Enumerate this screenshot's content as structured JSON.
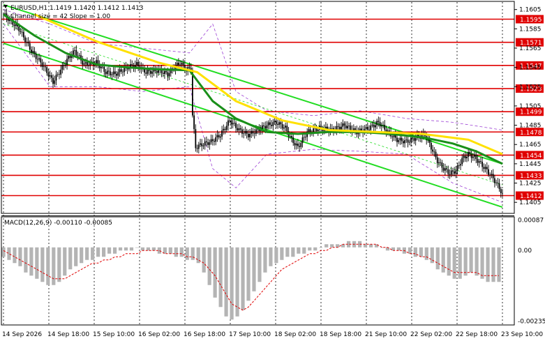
{
  "chart_data": {
    "type": "candlestick",
    "header": {
      "symbol_line": "EURUSD,H1  1.1419 1.1420 1.1412 1.1413",
      "channel_line": "Channel size = 42 Slope = 1.00"
    },
    "price_axis": {
      "ylim": [
        1.1395,
        1.1612
      ],
      "ticks": [
        "1.1605",
        "1.1585",
        "1.1565",
        "1.1545",
        "1.1525",
        "1.1505",
        "1.1485",
        "1.1465",
        "1.1445",
        "1.1425",
        "1.1405"
      ]
    },
    "levels": [
      {
        "value": 1.1595,
        "label": "1.1595"
      },
      {
        "value": 1.1571,
        "label": "1.1571"
      },
      {
        "value": 1.1547,
        "label": "1.1547"
      },
      {
        "value": 1.1523,
        "label": "1.1523"
      },
      {
        "value": 1.1499,
        "label": "1.1499"
      },
      {
        "value": 1.1478,
        "label": "1.1478"
      },
      {
        "value": 1.1454,
        "label": "1.1454"
      },
      {
        "value": 1.1433,
        "label": "1.1433"
      },
      {
        "value": 1.1412,
        "label": "1.1412"
      }
    ],
    "level_color": "#e00000",
    "time_axis": {
      "labels": [
        "14 Sep 2026",
        "14 Sep 18:00",
        "15 Sep 10:00",
        "16 Sep 02:00",
        "16 Sep 18:00",
        "17 Sep 10:00",
        "18 Sep 02:00",
        "18 Sep 18:00",
        "21 Sep 10:00",
        "22 Sep 02:00",
        "22 Sep 18:00",
        "23 Sep 10:00"
      ]
    },
    "close_path": [
      [
        0,
        1.16
      ],
      [
        10,
        1.1585
      ],
      [
        18,
        1.1562
      ],
      [
        25,
        1.1548
      ],
      [
        32,
        1.153
      ],
      [
        36,
        1.154
      ],
      [
        42,
        1.1555
      ],
      [
        46,
        1.1562
      ],
      [
        52,
        1.1548
      ],
      [
        60,
        1.155
      ],
      [
        66,
        1.154
      ],
      [
        72,
        1.1538
      ],
      [
        80,
        1.1545
      ],
      [
        86,
        1.1548
      ],
      [
        92,
        1.154
      ],
      [
        100,
        1.1542
      ],
      [
        106,
        1.1538
      ],
      [
        110,
        1.1545
      ],
      [
        114,
        1.155
      ],
      [
        118,
        1.1542
      ],
      [
        121,
        1.1545
      ],
      [
        122,
        1.1495
      ],
      [
        124,
        1.1462
      ],
      [
        128,
        1.1465
      ],
      [
        134,
        1.1468
      ],
      [
        140,
        1.1475
      ],
      [
        146,
        1.149
      ],
      [
        152,
        1.148
      ],
      [
        158,
        1.1475
      ],
      [
        164,
        1.148
      ],
      [
        170,
        1.1485
      ],
      [
        176,
        1.1488
      ],
      [
        182,
        1.1482
      ],
      [
        186,
        1.147
      ],
      [
        190,
        1.1462
      ],
      [
        196,
        1.1478
      ],
      [
        204,
        1.1482
      ],
      [
        212,
        1.148
      ],
      [
        220,
        1.1485
      ],
      [
        228,
        1.1478
      ],
      [
        236,
        1.1482
      ],
      [
        242,
        1.1488
      ],
      [
        248,
        1.1478
      ],
      [
        254,
        1.147
      ],
      [
        260,
        1.1468
      ],
      [
        266,
        1.1472
      ],
      [
        272,
        1.1475
      ],
      [
        276,
        1.1462
      ],
      [
        280,
        1.1448
      ],
      [
        284,
        1.144
      ],
      [
        288,
        1.1435
      ],
      [
        292,
        1.1438
      ],
      [
        296,
        1.145
      ],
      [
        300,
        1.1455
      ],
      [
        304,
        1.1452
      ],
      [
        308,
        1.1445
      ],
      [
        312,
        1.1438
      ],
      [
        316,
        1.143
      ],
      [
        320,
        1.142
      ],
      [
        322,
        1.1413
      ]
    ],
    "moving_averages": [
      {
        "color": "#1a8f1a",
        "values": [
          [
            0,
            1.16
          ],
          [
            20,
            1.1578
          ],
          [
            40,
            1.156
          ],
          [
            60,
            1.1548
          ],
          [
            80,
            1.1545
          ],
          [
            100,
            1.1543
          ],
          [
            120,
            1.1542
          ],
          [
            135,
            1.151
          ],
          [
            150,
            1.1492
          ],
          [
            170,
            1.1478
          ],
          [
            190,
            1.1476
          ],
          [
            210,
            1.1478
          ],
          [
            230,
            1.1478
          ],
          [
            250,
            1.1476
          ],
          [
            272,
            1.1472
          ],
          [
            290,
            1.1466
          ],
          [
            305,
            1.1458
          ],
          [
            322,
            1.1445
          ]
        ]
      },
      {
        "color": "#ffe100",
        "values": [
          [
            20,
            1.16
          ],
          [
            60,
            1.1572
          ],
          [
            100,
            1.155
          ],
          [
            125,
            1.154
          ],
          [
            150,
            1.151
          ],
          [
            180,
            1.149
          ],
          [
            210,
            1.148
          ],
          [
            240,
            1.1478
          ],
          [
            270,
            1.1476
          ],
          [
            300,
            1.147
          ],
          [
            322,
            1.1455
          ]
        ]
      }
    ],
    "bollinger": {
      "color": "#9b3fd4",
      "upper": [
        [
          0,
          1.1605
        ],
        [
          30,
          1.159
        ],
        [
          60,
          1.157
        ],
        [
          90,
          1.1565
        ],
        [
          120,
          1.156
        ],
        [
          135,
          1.159
        ],
        [
          150,
          1.152
        ],
        [
          170,
          1.15
        ],
        [
          200,
          1.1495
        ],
        [
          230,
          1.15
        ],
        [
          260,
          1.1492
        ],
        [
          290,
          1.1488
        ],
        [
          322,
          1.148
        ]
      ],
      "lower": [
        [
          0,
          1.159
        ],
        [
          30,
          1.1525
        ],
        [
          60,
          1.1525
        ],
        [
          90,
          1.152
        ],
        [
          120,
          1.1525
        ],
        [
          135,
          1.144
        ],
        [
          150,
          1.142
        ],
        [
          170,
          1.1455
        ],
        [
          200,
          1.146
        ],
        [
          230,
          1.1458
        ],
        [
          260,
          1.1455
        ],
        [
          290,
          1.1425
        ],
        [
          322,
          1.1405
        ]
      ]
    },
    "channel": {
      "color": "#22dd22",
      "upper": [
        [
          0,
          1.161
        ],
        [
          322,
          1.1445
        ]
      ],
      "lower": [
        [
          0,
          1.157
        ],
        [
          322,
          1.14
        ]
      ],
      "middle": [
        [
          0,
          1.159
        ],
        [
          322,
          1.1423
        ]
      ]
    },
    "macd": {
      "label": "MACD(12,26,9) -0.00110 -0.00085",
      "ticks": [
        "0.00087",
        "0.00",
        "-0.00235"
      ],
      "histogram": [
        -0.0003,
        -0.0004,
        -0.0005,
        -0.0006,
        -0.0008,
        -0.0009,
        -0.001,
        -0.0011,
        -0.0012,
        -0.0012,
        -0.0011,
        -0.0009,
        -0.0007,
        -0.0006,
        -0.0005,
        -0.0004,
        -0.0004,
        -0.0003,
        -0.0003,
        -0.0002,
        -0.0002,
        -0.0001,
        -0.0001,
        -0.0001,
        0.0,
        -0.0001,
        -0.0001,
        -0.0001,
        -0.0002,
        -0.0002,
        -0.0002,
        -0.0003,
        -0.0003,
        -0.0004,
        -0.0004,
        -0.0005,
        -0.0008,
        -0.0012,
        -0.0016,
        -0.0019,
        -0.0022,
        -0.0023,
        -0.0022,
        -0.002,
        -0.0017,
        -0.0014,
        -0.0011,
        -0.0008,
        -0.0006,
        -0.0005,
        -0.0004,
        -0.0003,
        -0.0003,
        -0.0002,
        -0.0002,
        -0.0001,
        -0.0001,
        0.0,
        0.0001,
        0.0001,
        0.0001,
        0.0001,
        0.0002,
        0.0002,
        0.0002,
        0.0001,
        0.0001,
        0.0001,
        0.0,
        -0.0001,
        -0.0001,
        -0.0001,
        -0.0002,
        -0.0002,
        -0.0003,
        -0.0003,
        -0.0004,
        -0.0005,
        -0.0007,
        -0.0008,
        -0.0009,
        -0.001,
        -0.001,
        -0.0009,
        -0.0008,
        -0.0009,
        -0.001,
        -0.0011,
        -0.0011,
        -0.0011
      ],
      "signal": [
        -0.0001,
        -0.0002,
        -0.0003,
        -0.0004,
        -0.0005,
        -0.0006,
        -0.0007,
        -0.0008,
        -0.0009,
        -0.001,
        -0.001,
        -0.001,
        -0.0009,
        -0.0008,
        -0.0007,
        -0.0006,
        -0.0005,
        -0.0005,
        -0.0004,
        -0.0004,
        -0.0003,
        -0.0003,
        -0.0002,
        -0.0002,
        -0.0002,
        -0.0001,
        -0.0001,
        -0.0001,
        -0.0001,
        -0.0002,
        -0.0002,
        -0.0002,
        -0.0002,
        -0.0003,
        -0.0003,
        -0.0004,
        -0.0005,
        -0.0007,
        -0.0009,
        -0.0012,
        -0.0015,
        -0.0018,
        -0.0019,
        -0.002,
        -0.0019,
        -0.0017,
        -0.0015,
        -0.0013,
        -0.0011,
        -0.0009,
        -0.0007,
        -0.0006,
        -0.0005,
        -0.0004,
        -0.0003,
        -0.0002,
        -0.0002,
        -0.0001,
        -0.0001,
        0.0,
        0.0,
        0.0001,
        0.0001,
        0.0001,
        0.0001,
        0.0001,
        0.0001,
        0.0001,
        0.0,
        0.0,
        -0.0001,
        -0.0001,
        -0.0001,
        -0.0002,
        -0.0002,
        -0.0003,
        -0.0003,
        -0.0004,
        -0.0005,
        -0.0006,
        -0.0007,
        -0.0008,
        -0.0008,
        -0.0008,
        -0.0008,
        -0.0008,
        -0.0009,
        -0.0009,
        -0.0009,
        -0.0009
      ],
      "ylim": [
        -0.00245,
        0.00095
      ],
      "histogram_color": "#b4b4b4",
      "signal_color": "#e00000"
    }
  }
}
